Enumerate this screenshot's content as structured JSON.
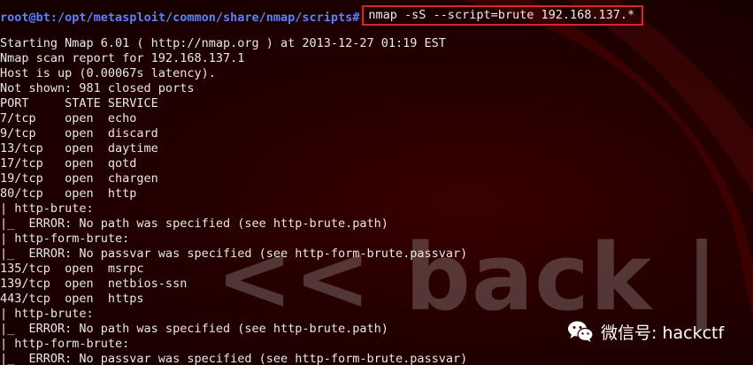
{
  "prompt": {
    "user_host": "root@bt",
    "path": ":/opt/metasploit/common/share/nmap/scripts#",
    "command": "nmap -sS --script=brute 192.168.137.*"
  },
  "output_lines": [
    "Starting Nmap 6.01 ( http://nmap.org ) at 2013-12-27 01:19 EST",
    "Nmap scan report for 192.168.137.1",
    "Host is up (0.00067s latency).",
    "Not shown: 981 closed ports",
    "PORT     STATE SERVICE",
    "7/tcp    open  echo",
    "9/tcp    open  discard",
    "13/tcp   open  daytime",
    "17/tcp   open  qotd",
    "19/tcp   open  chargen",
    "80/tcp   open  http",
    "| http-brute:",
    "|_  ERROR: No path was specified (see http-brute.path)",
    "| http-form-brute:",
    "|_  ERROR: No passvar was specified (see http-form-brute.passvar)",
    "135/tcp  open  msrpc",
    "139/tcp  open  netbios-ssn",
    "443/tcp  open  https",
    "| http-brute:",
    "|_  ERROR: No path was specified (see http-brute.path)",
    "| http-form-brute:",
    "|_  ERROR: No passvar was specified (see http-form-brute.passvar)"
  ],
  "watermark": {
    "text": "<< back | trac"
  },
  "wechat": {
    "label": "微信号: hackctf",
    "icon": "wechat-icon"
  },
  "colors": {
    "background": "#260000",
    "prompt": "#5f7fff",
    "text": "#e8e8e8",
    "highlight_box": "#d6262c"
  }
}
